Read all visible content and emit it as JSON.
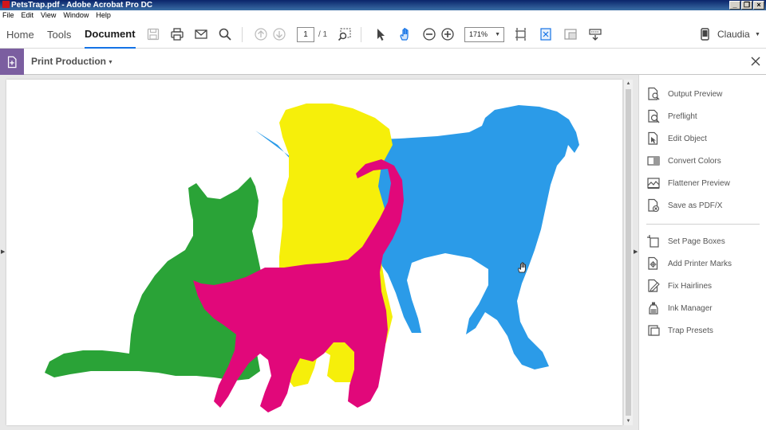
{
  "window": {
    "title": "PetsTrap.pdf - Adobe Acrobat Pro DC"
  },
  "menu": [
    "File",
    "Edit",
    "View",
    "Window",
    "Help"
  ],
  "nav": {
    "home": "Home",
    "tools": "Tools",
    "document": "Document"
  },
  "page_nav": {
    "current": "1",
    "total": "/ 1"
  },
  "zoom": {
    "value": "171%"
  },
  "user": {
    "name": "Claudia"
  },
  "tool_header": {
    "title": "Print Production"
  },
  "panel": {
    "group1": [
      {
        "label": "Output Preview",
        "icon": "output-preview-icon"
      },
      {
        "label": "Preflight",
        "icon": "preflight-icon"
      },
      {
        "label": "Edit Object",
        "icon": "edit-object-icon"
      },
      {
        "label": "Convert Colors",
        "icon": "convert-colors-icon"
      },
      {
        "label": "Flattener Preview",
        "icon": "flattener-preview-icon"
      },
      {
        "label": "Save as PDF/X",
        "icon": "save-as-pdfx-icon"
      }
    ],
    "group2": [
      {
        "label": "Set Page Boxes",
        "icon": "set-page-boxes-icon"
      },
      {
        "label": "Add Printer Marks",
        "icon": "add-printer-marks-icon"
      },
      {
        "label": "Fix Hairlines",
        "icon": "fix-hairlines-icon"
      },
      {
        "label": "Ink Manager",
        "icon": "ink-manager-icon"
      },
      {
        "label": "Trap Presets",
        "icon": "trap-presets-icon"
      }
    ]
  },
  "artwork": {
    "colors": {
      "cyan": "#2b9be8",
      "yellow": "#f6ef0a",
      "green": "#2aa337",
      "magenta": "#e1087a"
    }
  },
  "colors": {
    "accent": "#1473e6",
    "tool_tile": "#7b5ea0"
  }
}
